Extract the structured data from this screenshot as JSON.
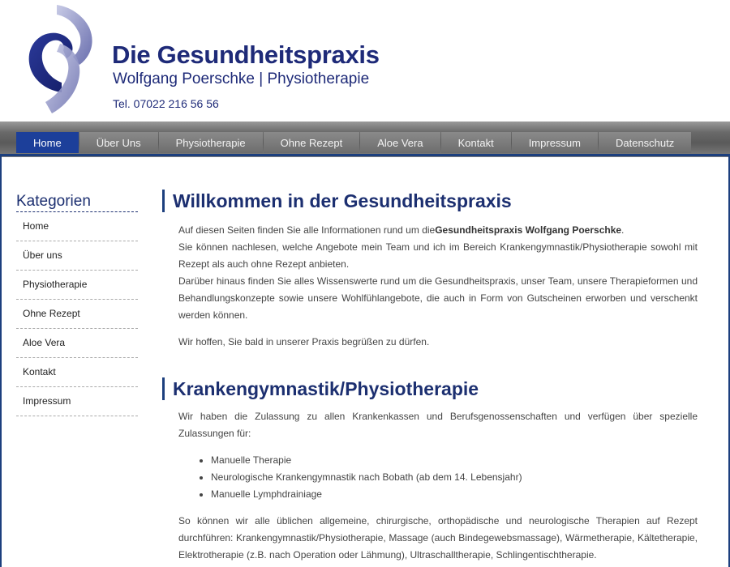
{
  "header": {
    "brand_title": "Die Gesundheitspraxis",
    "brand_subtitle": "Wolfgang Poerschke | Physiotherapie",
    "phone": "Tel. 07022 216 56 56"
  },
  "nav": {
    "items": [
      {
        "label": "Home",
        "active": true
      },
      {
        "label": "Über Uns"
      },
      {
        "label": "Physiotherapie"
      },
      {
        "label": "Ohne Rezept"
      },
      {
        "label": "Aloe Vera"
      },
      {
        "label": "Kontakt"
      },
      {
        "label": "Impressum"
      },
      {
        "label": "Datenschutz"
      }
    ]
  },
  "sidebar": {
    "title": "Kategorien",
    "items": [
      {
        "label": "Home"
      },
      {
        "label": "Über uns"
      },
      {
        "label": "Physiotherapie"
      },
      {
        "label": "Ohne Rezept"
      },
      {
        "label": "Aloe Vera"
      },
      {
        "label": "Kontakt"
      },
      {
        "label": "Impressum"
      }
    ]
  },
  "main": {
    "welcome": {
      "title": "Willkommen in der Gesundheitspraxis",
      "p1_before": "Auf diesen Seiten finden Sie alle Informationen rund um die",
      "p1_bold": "Gesundheitspraxis Wolfgang Poerschke",
      "p1_after": ".",
      "p2": "Sie können nachlesen, welche Angebote mein Team und ich im Bereich Krankengymnastik/Physiotherapie sowohl mit Rezept als auch ohne Rezept anbieten.",
      "p3": "Darüber hinaus finden Sie alles Wissenswerte rund um die Gesundheitspraxis, unser Team, unsere Therapieformen und Behandlungskonzepte sowie unsere Wohlfühlangebote, die auch in Form von Gutscheinen erworben und verschenkt werden können.",
      "p4": "Wir hoffen, Sie bald in unserer Praxis begrüßen zu dürfen."
    },
    "physio": {
      "title": "Krankengymnastik/Physiotherapie",
      "intro": "Wir haben die Zulassung zu allen Krankenkassen und Berufsgenossenschaften und verfügen über spezielle Zulassungen für:",
      "bullets": [
        "Manuelle Therapie",
        "Neurologische Krankengymnastik nach Bobath (ab dem 14. Lebensjahr)",
        "Manuelle Lymphdrainiage"
      ],
      "outro": "So können wir alle üblichen allgemeine, chirurgische, orthopädische und neurologische Therapien auf Rezept durchführen: Krankengymnastik/Physiotherapie, Massage (auch Bindegewebsmassage), Wärmetherapie, Kältetherapie, Elektrotherapie (z.B. nach Operation oder Lähmung), Ultraschalltherapie, Schlingentischtherapie."
    }
  },
  "colors": {
    "brand": "#1e2a78",
    "nav_active": "#1c3f9a",
    "nav_bar": "#6a6a6a",
    "accent_line": "#1c3f7e"
  }
}
